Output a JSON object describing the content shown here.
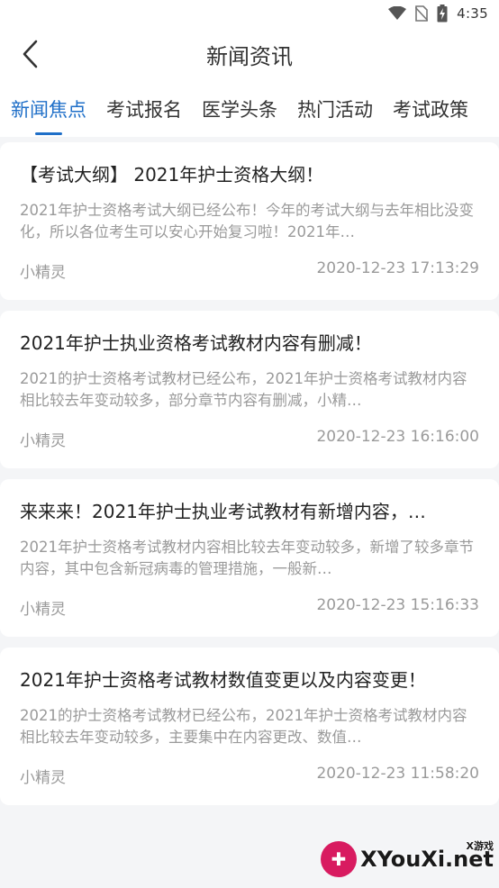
{
  "status_bar": {
    "time": "4:35",
    "icons": [
      "wifi-icon",
      "no-sim-icon",
      "battery-charging-icon"
    ]
  },
  "header": {
    "title": "新闻资讯",
    "back_icon": "chevron-left-icon"
  },
  "tabs": [
    {
      "label": "新闻焦点",
      "active": true
    },
    {
      "label": "考试报名",
      "active": false
    },
    {
      "label": "医学头条",
      "active": false
    },
    {
      "label": "热门活动",
      "active": false
    },
    {
      "label": "考试政策",
      "active": false
    }
  ],
  "articles": [
    {
      "title": "【考试大纲】 2021年护士资格大纲！",
      "summary": "2021年护士资格考试大纲已经公布！今年的考试大纲与去年相比没变化，所以各位考生可以安心开始复习啦！2021年…",
      "author": "小精灵",
      "datetime": "2020-12-23 17:13:29"
    },
    {
      "title": "2021年护士执业资格考试教材内容有删减！",
      "summary": "2021的护士资格考试教材已经公布，2021年护士资格考试教材内容相比较去年变动较多，部分章节内容有删减，小精…",
      "author": "小精灵",
      "datetime": "2020-12-23 16:16:00"
    },
    {
      "title": "来来来！2021年护士执业考试教材有新增内容，…",
      "summary": "2021年护士资格考试教材内容相比较去年变动较多，新增了较多章节内容，其中包含新冠病毒的管理措施，一般新…",
      "author": "小精灵",
      "datetime": "2020-12-23 15:16:33"
    },
    {
      "title": "2021年护士资格考试教材数值变更以及内容变更！",
      "summary": "2021的护士资格考试教材已经公布，2021年护士资格考试教材内容相比较去年变动较多，主要集中在内容更改、数值…",
      "author": "小精灵",
      "datetime": "2020-12-23 11:58:20"
    }
  ],
  "watermark": {
    "text": "XYouXi.net",
    "sub": "X游戏"
  },
  "colors": {
    "accent": "#1f6fc8",
    "background": "#f4f5f7",
    "muted_text": "#9a9a9a"
  }
}
